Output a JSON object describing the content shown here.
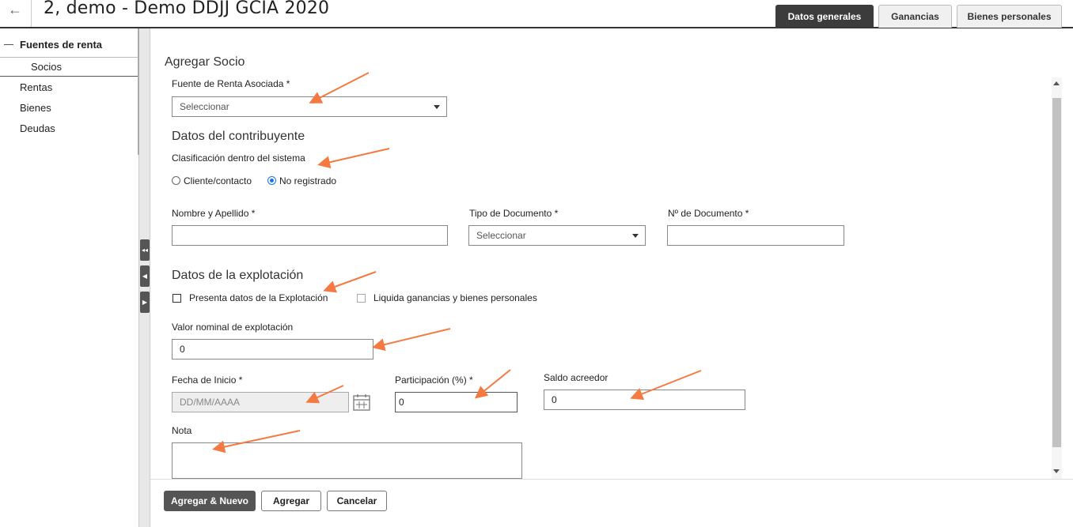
{
  "header": {
    "back_icon": "←",
    "title": "2, demo - Demo DDJJ GCIA 2020",
    "tabs": [
      "Datos generales",
      "Ganancias",
      "Bienes personales"
    ]
  },
  "sidebar": {
    "group_label": "Fuentes de renta",
    "sub_label": "Socios",
    "items": [
      "Rentas",
      "Bienes",
      "Deudas"
    ]
  },
  "form": {
    "title": "Agregar Socio",
    "fuente_label": "Fuente de Renta Asociada *",
    "fuente_value": "Seleccionar",
    "contribuyente_section": "Datos del contribuyente",
    "clasificacion_label": "Clasificación dentro del sistema",
    "radio_cliente": "Cliente/contacto",
    "radio_no_registrado": "No registrado",
    "nombre_label": "Nombre y Apellido *",
    "nombre_value": "",
    "tipo_doc_label": "Tipo de Documento *",
    "tipo_doc_value": "Seleccionar",
    "nro_doc_label": "Nº de Documento *",
    "nro_doc_value": "",
    "explotacion_section": "Datos de la explotación",
    "presenta_label": "Presenta datos de la Explotación",
    "liquida_label": "Liquida ganancias y bienes personales",
    "valor_label": "Valor nominal de explotación",
    "valor_value": "0",
    "fecha_label": "Fecha de Inicio  *",
    "fecha_placeholder": "DD/MM/AAAA",
    "participacion_label": "Participación (%) *",
    "participacion_value": "0",
    "saldo_label": "Saldo acreedor",
    "saldo_value": "0",
    "nota_label": "Nota"
  },
  "buttons": {
    "agregar_nuevo": "Agregar & Nuevo",
    "agregar": "Agregar",
    "cancelar": "Cancelar"
  },
  "colors": {
    "annotation_arrow": "#f47a42",
    "active_tab": "#3c3c3c",
    "radio_accent": "#1a73e8"
  }
}
